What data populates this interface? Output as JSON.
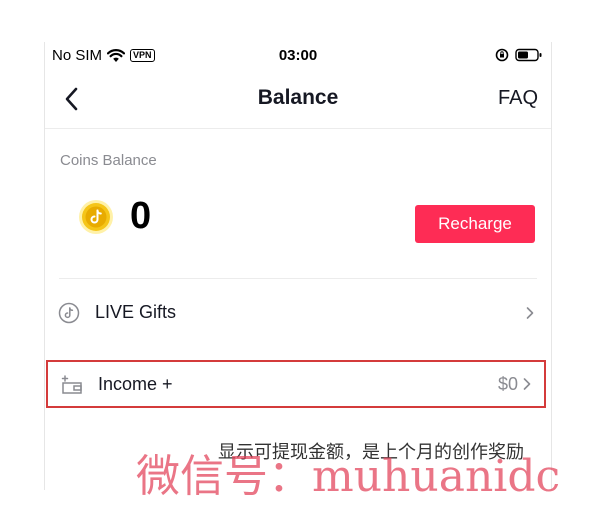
{
  "status_bar": {
    "carrier": "No SIM",
    "vpn": "VPN",
    "time": "03:00"
  },
  "nav": {
    "title": "Balance",
    "faq": "FAQ"
  },
  "coins": {
    "label": "Coins Balance",
    "amount": "0",
    "recharge_label": "Recharge"
  },
  "rows": {
    "live_gifts": "LIVE Gifts",
    "income_label": "Income +",
    "income_amount": "$0"
  },
  "annotation": "显示可提现金额，是上个月的创作奖励",
  "watermark": "微信号：muhuanidc",
  "colors": {
    "accent": "#fe2c55",
    "highlight_box": "#d43b3b",
    "coin_gold": "#f5c518"
  }
}
